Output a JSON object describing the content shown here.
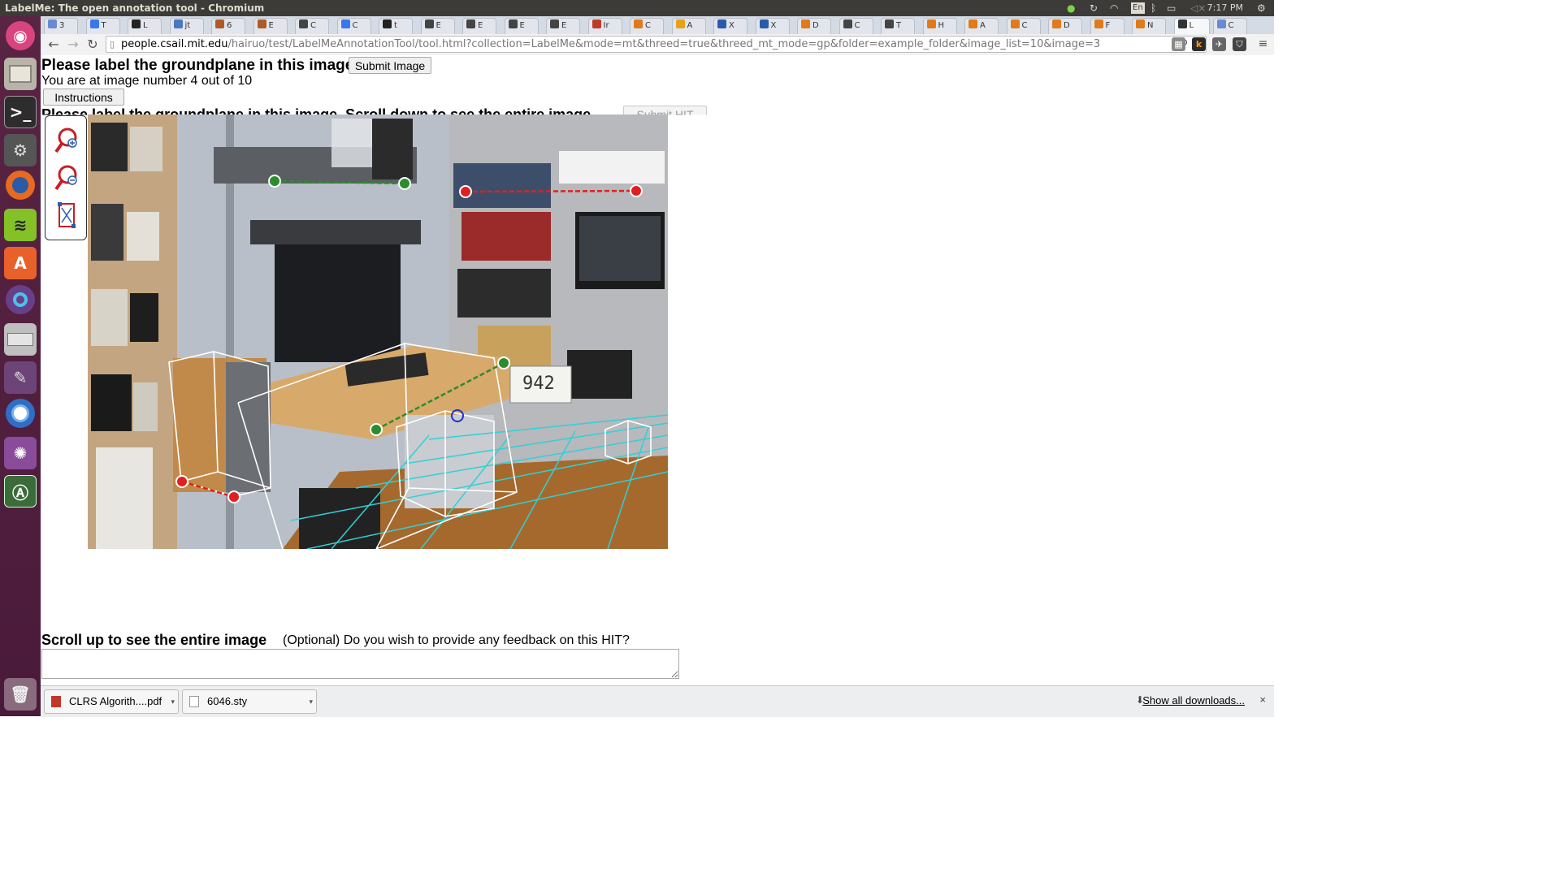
{
  "window": {
    "title": "LabelMe: The open annotation tool - Chromium",
    "clock": "7:17 PM",
    "keyboard": "En"
  },
  "tabs": [
    {
      "label": "3",
      "color": "#6a8bd0"
    },
    {
      "label": "T",
      "color": "#3a77e8"
    },
    {
      "label": "L",
      "color": "#222"
    },
    {
      "label": "jt",
      "color": "#4a78c0"
    },
    {
      "label": "6",
      "color": "#b05a2a"
    },
    {
      "label": "E",
      "color": "#b05a2a"
    },
    {
      "label": "C",
      "color": "#444"
    },
    {
      "label": "C",
      "color": "#3a77e8"
    },
    {
      "label": "t",
      "color": "#222"
    },
    {
      "label": "E",
      "color": "#444"
    },
    {
      "label": "E",
      "color": "#444"
    },
    {
      "label": "E",
      "color": "#444"
    },
    {
      "label": "E",
      "color": "#444"
    },
    {
      "label": "Ir",
      "color": "#c0392b"
    },
    {
      "label": "C",
      "color": "#e07a1a"
    },
    {
      "label": "A",
      "color": "#e8a21a"
    },
    {
      "label": "X",
      "color": "#2a5caa"
    },
    {
      "label": "X",
      "color": "#2a5caa"
    },
    {
      "label": "D",
      "color": "#e07a1a"
    },
    {
      "label": "C",
      "color": "#444"
    },
    {
      "label": "T",
      "color": "#444"
    },
    {
      "label": "H",
      "color": "#e07a1a"
    },
    {
      "label": "A",
      "color": "#e07a1a"
    },
    {
      "label": "C",
      "color": "#e07a1a"
    },
    {
      "label": "D",
      "color": "#e07a1a"
    },
    {
      "label": "F",
      "color": "#e07a1a"
    },
    {
      "label": "N",
      "color": "#e07a1a"
    },
    {
      "label": "L",
      "color": "#333",
      "active": true
    },
    {
      "label": "C",
      "color": "#6a8bd0"
    }
  ],
  "toolbar": {
    "url_host": "people.csail.mit.edu",
    "url_path": "/hairuo/test/LabelMeAnnotationTool/tool.html?collection=LabelMe&mode=mt&threed=true&threed_mt_mode=gp&folder=example_folder&image_list=10&image=3"
  },
  "page": {
    "heading": "Please label the groundplane in this image.",
    "submit_image": "Submit Image",
    "progress": "You are at image number 4 out of 10",
    "instructions": "Instructions",
    "scroll_heading": "Please label the groundplane in this image. Scroll down to see the entire image.",
    "submit_hit": "Submit HIT",
    "scroll_up": "Scroll up to see the entire image",
    "feedback_prompt": "(Optional) Do you wish to provide any feedback on this HIT?",
    "feedback_value": ""
  },
  "downloads": {
    "items": [
      {
        "name": "CLRS Algorith....pdf",
        "type": "pdf"
      },
      {
        "name": "6046.sty",
        "type": "file"
      }
    ],
    "show_all": "Show all downloads...",
    "close": "×"
  }
}
